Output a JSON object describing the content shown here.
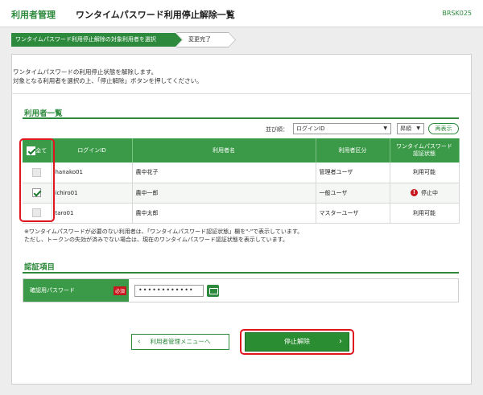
{
  "header": {
    "category": "利用者管理",
    "title": "ワンタイムパスワード利用停止解除一覧",
    "screen_code": "BRSK025"
  },
  "steps": [
    {
      "label": "ワンタイムパスワード利用停止解除の対象利用者を選択",
      "active": true
    },
    {
      "label": "変更完了",
      "active": false
    }
  ],
  "intro": {
    "line1": "ワンタイムパスワードの利用停止状態を解除します。",
    "line2": "対象となる利用者を選択の上、「停止解除」ボタンを押してください。"
  },
  "user_list": {
    "section_title": "利用者一覧",
    "sort_label": "並び順：",
    "sort_value": "ログインID",
    "order_value": "昇順",
    "resort_button": "再表示",
    "columns": {
      "all": "全て",
      "login_id": "ログインID",
      "name": "利用者名",
      "type": "利用者区分",
      "status_1": "ワンタイムパスワード",
      "status_2": "認証状態"
    },
    "rows": [
      {
        "login_id": "hanako01",
        "name": "農中花子",
        "type": "管理者ユーザ",
        "status": "利用可能",
        "checked": false,
        "stopped": false
      },
      {
        "login_id": "ichiro01",
        "name": "農中一郎",
        "type": "一般ユーザ",
        "status": "停止中",
        "checked": true,
        "stopped": true
      },
      {
        "login_id": "taro01",
        "name": "農中太郎",
        "type": "マスターユーザ",
        "status": "利用可能",
        "checked": false,
        "stopped": false
      }
    ],
    "note1": "※ワンタイムパスワードが必要のない利用者は、「ワンタイムパスワード認証状態」欄を\"-\"で表示しています。",
    "note2": "ただし、トークンの失効が済みでない場合は、現在のワンタイムパスワード認証状態を表示しています。"
  },
  "auth": {
    "section_title": "認証項目",
    "password_label": "確認用パスワード",
    "required_badge": "必須",
    "password_value": "••••••••••••"
  },
  "buttons": {
    "back": "利用者管理メニューへ",
    "submit": "停止解除"
  },
  "colors": {
    "brand_green": "#2d8a3c",
    "alert_red": "#c8161d",
    "highlight_red": "#e0161e"
  }
}
